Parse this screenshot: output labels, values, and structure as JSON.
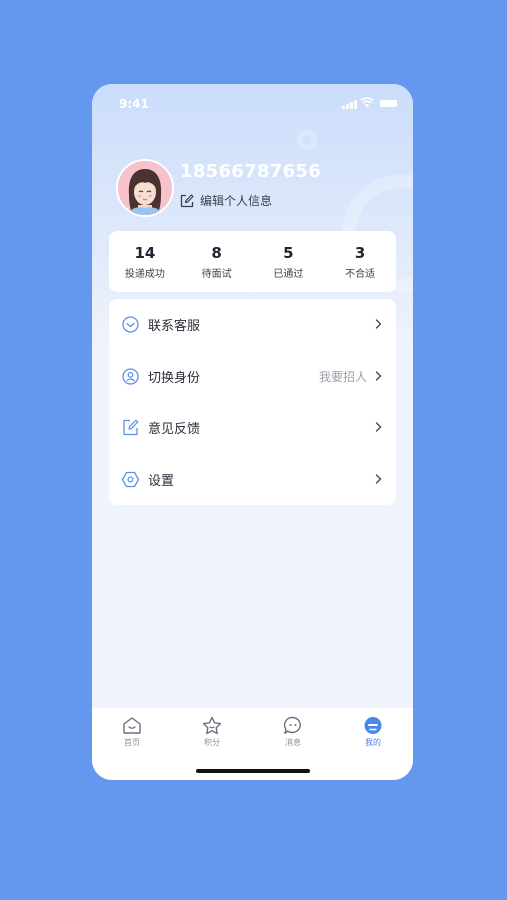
{
  "status_bar": {
    "time": "9:41"
  },
  "profile": {
    "phone": "18566787656",
    "edit_label": "编辑个人信息"
  },
  "stats": [
    {
      "value": "14",
      "label": "投递成功"
    },
    {
      "value": "8",
      "label": "待面试"
    },
    {
      "value": "5",
      "label": "已通过"
    },
    {
      "value": "3",
      "label": "不合适"
    }
  ],
  "menu": [
    {
      "label": "联系客服",
      "extra": "",
      "icon": "customer-service-icon"
    },
    {
      "label": "切换身份",
      "extra": "我要招人",
      "icon": "switch-identity-icon"
    },
    {
      "label": "意见反馈",
      "extra": "",
      "icon": "feedback-icon"
    },
    {
      "label": "设置",
      "extra": "",
      "icon": "settings-icon"
    }
  ],
  "tabs": [
    {
      "label": "首页",
      "icon": "home-icon"
    },
    {
      "label": "积分",
      "icon": "star-icon"
    },
    {
      "label": "消息",
      "icon": "message-icon"
    },
    {
      "label": "我的",
      "icon": "profile-icon",
      "active": true
    }
  ],
  "colors": {
    "background": "#6398ee",
    "accent": "#4b86ea",
    "card": "#ffffff"
  }
}
